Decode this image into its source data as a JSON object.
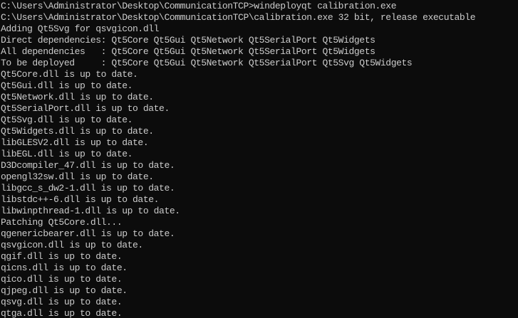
{
  "colors": {
    "background": "#0c0c0c",
    "text": "#cccccc"
  },
  "console": {
    "lines": [
      "C:\\Users\\Administrator\\Desktop\\CommunicationTCP>windeployqt calibration.exe",
      "C:\\Users\\Administrator\\Desktop\\CommunicationTCP\\calibration.exe 32 bit, release executable",
      "Adding Qt5Svg for qsvgicon.dll",
      "Direct dependencies: Qt5Core Qt5Gui Qt5Network Qt5SerialPort Qt5Widgets",
      "All dependencies   : Qt5Core Qt5Gui Qt5Network Qt5SerialPort Qt5Widgets",
      "To be deployed     : Qt5Core Qt5Gui Qt5Network Qt5SerialPort Qt5Svg Qt5Widgets",
      "Qt5Core.dll is up to date.",
      "Qt5Gui.dll is up to date.",
      "Qt5Network.dll is up to date.",
      "Qt5SerialPort.dll is up to date.",
      "Qt5Svg.dll is up to date.",
      "Qt5Widgets.dll is up to date.",
      "libGLESV2.dll is up to date.",
      "libEGL.dll is up to date.",
      "D3Dcompiler_47.dll is up to date.",
      "opengl32sw.dll is up to date.",
      "libgcc_s_dw2-1.dll is up to date.",
      "libstdc++-6.dll is up to date.",
      "libwinpthread-1.dll is up to date.",
      "Patching Qt5Core.dll...",
      "qgenericbearer.dll is up to date.",
      "qsvgicon.dll is up to date.",
      "qgif.dll is up to date.",
      "qicns.dll is up to date.",
      "qico.dll is up to date.",
      "qjpeg.dll is up to date.",
      "qsvg.dll is up to date.",
      "qtga.dll is up to date."
    ]
  }
}
